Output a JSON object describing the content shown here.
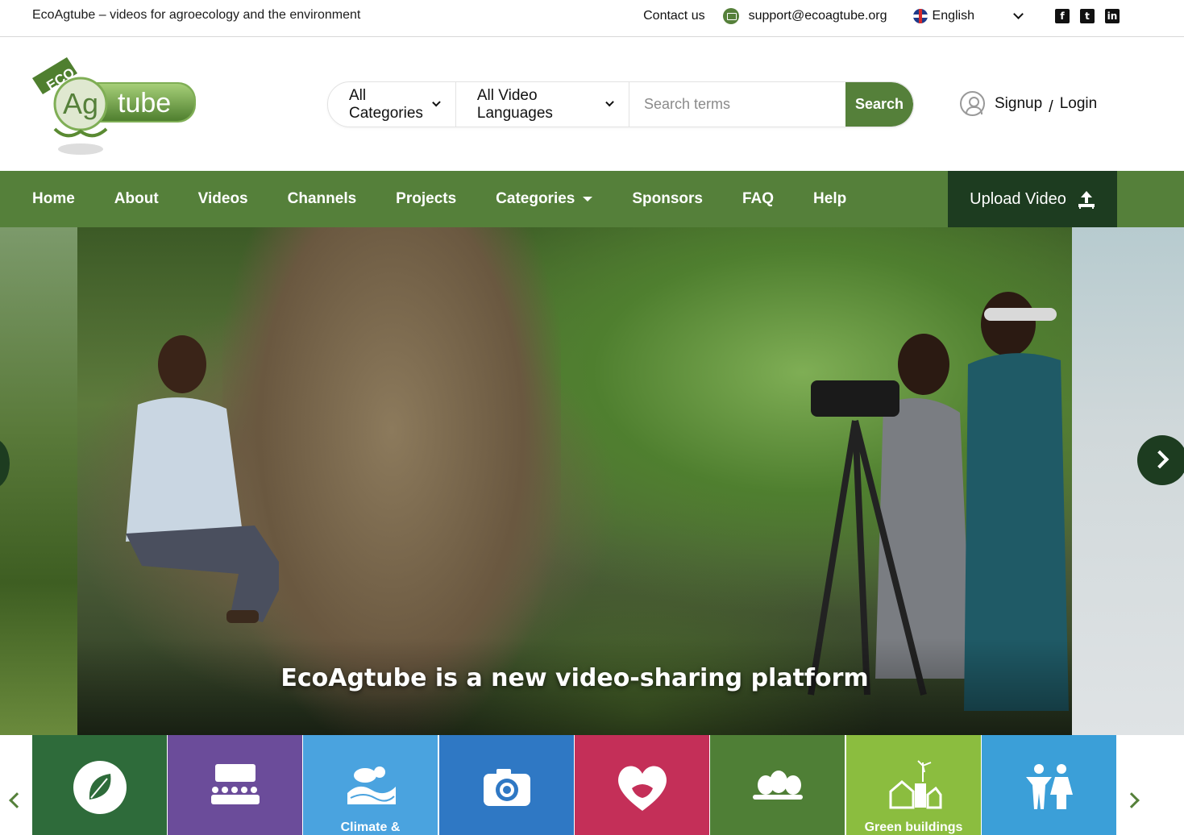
{
  "topbar": {
    "tagline": "EcoAgtube – videos for agroecology and the environment",
    "contact": "Contact us",
    "email": "support@ecoagtube.org",
    "language": "English",
    "social": [
      "facebook-icon",
      "twitter-icon",
      "linkedin-icon"
    ]
  },
  "header": {
    "logo_top": "ECO",
    "logo_ag": "Ag",
    "logo_tube": "tube",
    "search": {
      "category": "All Categories",
      "language": "All Video Languages",
      "placeholder": "Search terms",
      "button": "Search"
    },
    "signup": "Signup",
    "separator": "/",
    "login": "Login"
  },
  "nav": {
    "items": [
      "Home",
      "About",
      "Videos",
      "Channels",
      "Projects",
      "Categories",
      "Sponsors",
      "FAQ",
      "Help"
    ],
    "upload": "Upload Video"
  },
  "hero": {
    "caption": "EcoAgtube is a new video-sharing platform"
  },
  "categories": [
    {
      "icon": "leaf-icon",
      "color": "#2e6b3a",
      "label": ""
    },
    {
      "icon": "audience-icon",
      "color": "#6b4c9a",
      "label": ""
    },
    {
      "icon": "climate-icon",
      "color": "#4aa3df",
      "label": "Climate &"
    },
    {
      "icon": "camera-icon",
      "color": "#2f78c4",
      "label": ""
    },
    {
      "icon": "heart-icon",
      "color": "#c42f58",
      "label": ""
    },
    {
      "icon": "trees-icon",
      "color": "#4f7f36",
      "label": ""
    },
    {
      "icon": "green-building-icon",
      "color": "#8bbd3f",
      "label": "Green buildings"
    },
    {
      "icon": "people-icon",
      "color": "#3b9fd8",
      "label": ""
    }
  ],
  "colors": {
    "brand_green": "#55803a",
    "dark_green": "#1d3c20"
  }
}
